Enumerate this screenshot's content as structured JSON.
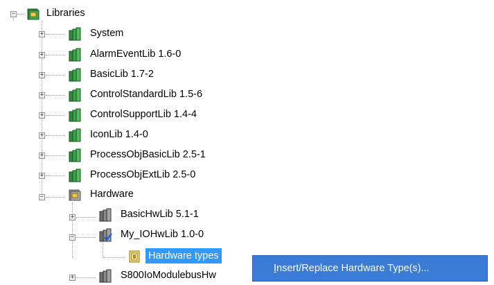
{
  "tree": {
    "root": {
      "label": "Libraries"
    },
    "items": [
      {
        "label": "System"
      },
      {
        "label": "AlarmEventLib 1.6-0"
      },
      {
        "label": "BasicLib 1.7-2"
      },
      {
        "label": "ControlStandardLib 1.5-6"
      },
      {
        "label": "ControlSupportLib 1.4-4"
      },
      {
        "label": "IconLib 1.4-0"
      },
      {
        "label": "ProcessObjBasicLib 2.5-1"
      },
      {
        "label": "ProcessObjExtLib 2.5-0"
      },
      {
        "label": "Hardware"
      },
      {
        "label": "BasicHwLib 5.1-1"
      },
      {
        "label": "My_IOHwLib 1.0-0"
      },
      {
        "label": "Hardware types"
      },
      {
        "label": "S800IoModulebusHw"
      }
    ]
  },
  "context_menu": {
    "items": [
      {
        "accel": "I",
        "label_rest": "nsert/Replace Hardware Type(s)..."
      }
    ]
  },
  "colors": {
    "selection": "#3399ff",
    "menu_highlight": "#3a7bd5",
    "library_icon": "#2e8b3a"
  }
}
